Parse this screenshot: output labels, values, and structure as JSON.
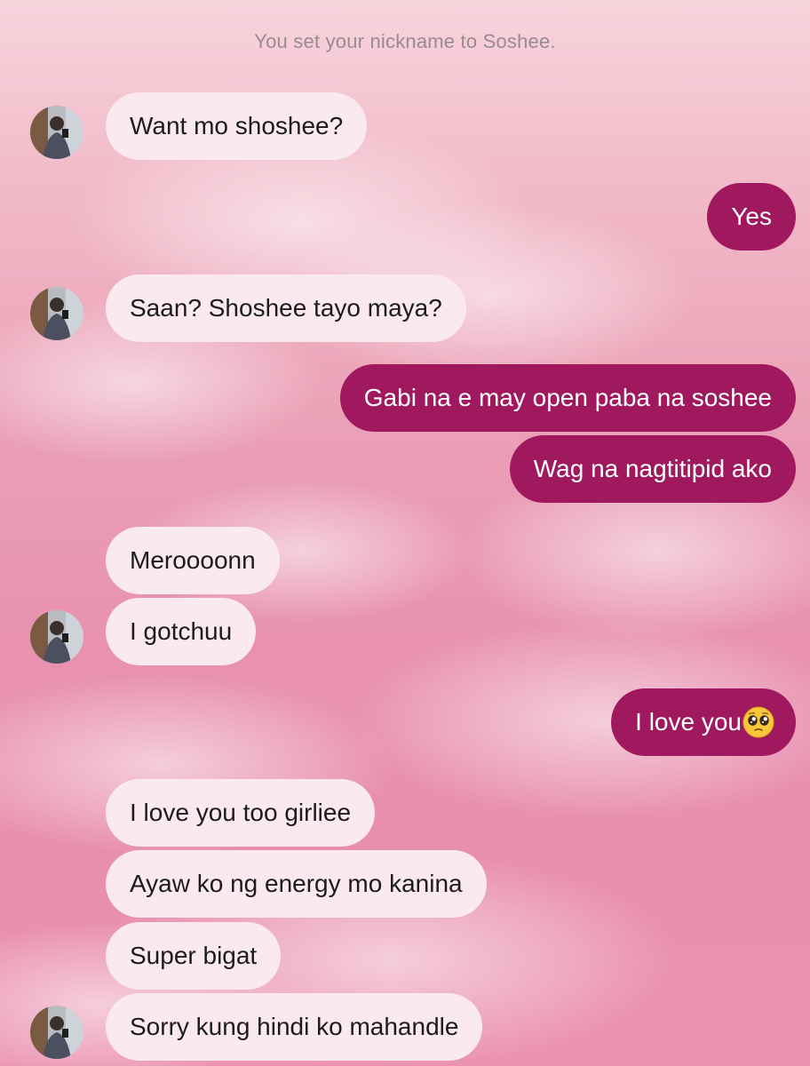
{
  "conversation": {
    "system_note": "You set your nickname to Soshee.",
    "messages": [
      {
        "side": "in",
        "text": "Want mo shoshee?",
        "avatar": true
      },
      {
        "side": "out",
        "text": "Yes"
      },
      {
        "side": "in",
        "text": "Saan? Shoshee tayo maya?",
        "avatar": true
      },
      {
        "side": "out",
        "text": "Gabi na e may open paba na soshee"
      },
      {
        "side": "out",
        "text": "Wag na nagtitipid ako"
      },
      {
        "side": "in",
        "text": "Meroooonn"
      },
      {
        "side": "in",
        "text": "I gotchuu",
        "avatar": true
      },
      {
        "side": "out",
        "text": "I love you",
        "emoji": "pleading-face-emoji"
      },
      {
        "side": "in",
        "text": "I love you too girliee"
      },
      {
        "side": "in",
        "text": "Ayaw ko ng energy mo kanina"
      },
      {
        "side": "in",
        "text": "Super bigat"
      },
      {
        "side": "in",
        "text": "Sorry kung hindi ko mahandle",
        "avatar": true
      }
    ]
  },
  "theme": {
    "incoming_bubble": "#fbe9f0",
    "outgoing_bubble": "#a0195e",
    "incoming_text": "#1c1c1e",
    "outgoing_text": "#ffffff",
    "system_text": "#9a8a90"
  }
}
